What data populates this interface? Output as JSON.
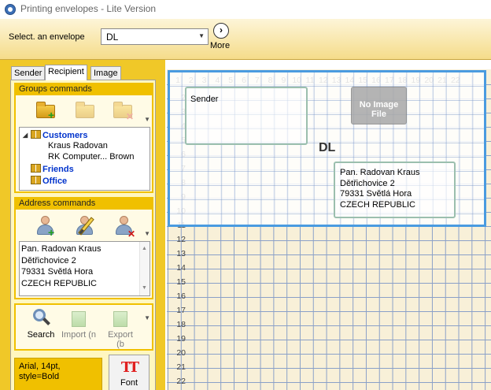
{
  "window": {
    "title": "Printing envelopes - Lite Version"
  },
  "top": {
    "envelope_label": "Select. an envelope",
    "envelope_value": "DL",
    "more_label": "More"
  },
  "tabs": [
    "Sender",
    "Recipient",
    "Image"
  ],
  "active_tab": "Recipient",
  "groups": {
    "header": "Groups commands",
    "tree": [
      {
        "label": "Customers",
        "level": 0,
        "bold": true,
        "expanded": true
      },
      {
        "label": "Kraus Radovan",
        "level": 1,
        "bold": false
      },
      {
        "label": "RK Computer... Brown",
        "level": 1,
        "bold": false
      },
      {
        "label": "Friends",
        "level": 0,
        "bold": true
      },
      {
        "label": "Office",
        "level": 0,
        "bold": true
      }
    ]
  },
  "address": {
    "header": "Address commands",
    "lines": [
      "Pan.  Radovan  Kraus",
      "Dětřichovice  2",
      "79331  Světlá Hora",
      "CZECH REPUBLIC"
    ]
  },
  "commands": {
    "search": "Search",
    "import": "Import (n",
    "export": "Export (b"
  },
  "font": {
    "info": "Arial, 14pt, style=Bold",
    "button": "Font"
  },
  "canvas": {
    "x_ticks": [
      "1",
      "2",
      "3",
      "4",
      "5",
      "6",
      "7",
      "8",
      "9",
      "10",
      "11",
      "12",
      "13",
      "14",
      "15",
      "16",
      "17",
      "18",
      "19",
      "20",
      "21",
      "22"
    ],
    "y_ticks": [
      "2",
      "3",
      "4",
      "5",
      "6",
      "7",
      "8",
      "9",
      "10",
      "11",
      "12",
      "13",
      "14",
      "15",
      "16",
      "17",
      "18",
      "19",
      "20",
      "21",
      "22"
    ],
    "sender_label": "Sender",
    "no_image": "No Image File",
    "envelope_name": "DL",
    "recipient_lines": [
      "Pan.  Radovan  Kraus",
      "Dětřichovice  2",
      "79331  Světlá Hora",
      "CZECH REPUBLIC"
    ]
  },
  "colors": {
    "panel": "#f0c828",
    "group_header": "#f0c000",
    "envelope_border": "#4a9be0",
    "tree_bold": "#0033cc"
  }
}
